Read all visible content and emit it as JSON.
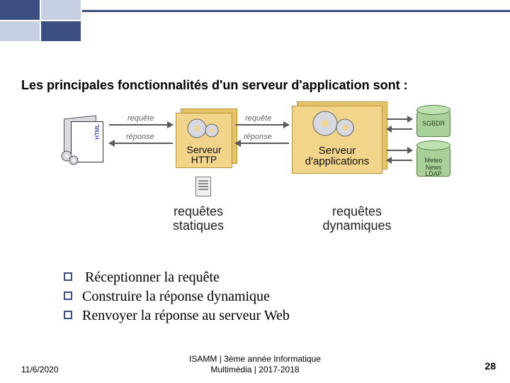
{
  "header": {
    "title": "Les principales fonctionnalités d'un serveur d'application sont :"
  },
  "diagram": {
    "client_tag": "HTML",
    "arrows": {
      "req": "requête",
      "resp": "réponse"
    },
    "http_label": "Serveur\nHTTP",
    "app_label": "Serveur\nd'applications",
    "left_caption": "requêtes\nstatiques",
    "right_caption": "requêtes\ndynamiques",
    "db1": "SGBDR",
    "db2": "Meteo\nNews\nLDAP"
  },
  "bullets": [
    "Réceptionner la requête",
    "Construire la réponse dynamique",
    "Renvoyer la réponse au serveur Web"
  ],
  "footer": {
    "date": "11/6/2020",
    "center1": "ISAMM | 3ème année Informatique",
    "center2": "Multimédia | 2017-2018",
    "page": "28"
  }
}
